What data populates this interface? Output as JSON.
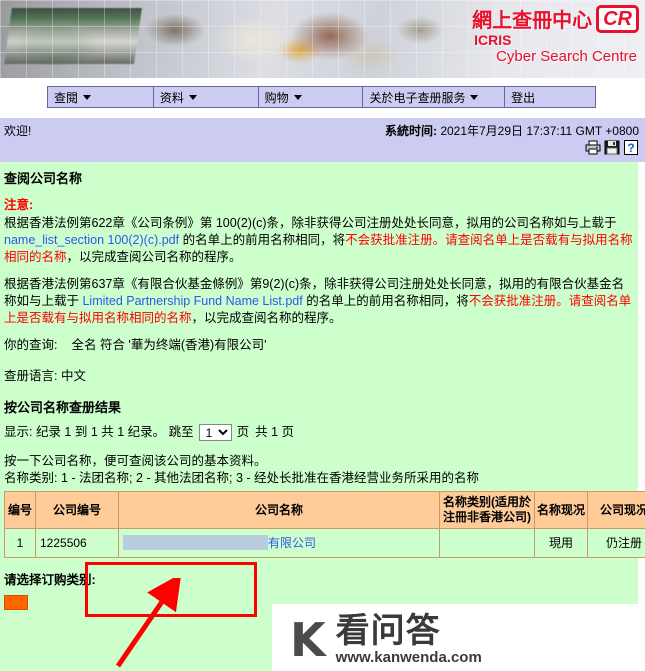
{
  "banner": {
    "logo_cn": "網上查冊中心",
    "logo_badge": "CR",
    "logo_icris": "ICRIS",
    "logo_tagline": "Cyber Search Centre"
  },
  "nav": {
    "items": [
      {
        "label": "查閱",
        "has_caret": true
      },
      {
        "label": "资料",
        "has_caret": true
      },
      {
        "label": "购物",
        "has_caret": true
      },
      {
        "label": "关於电子查册服务",
        "has_caret": true
      },
      {
        "label": "登出",
        "has_caret": false
      }
    ]
  },
  "welcome": {
    "greeting": "欢迎!",
    "systime_label": "系統时间:",
    "systime_value": "2021年7月29日 17:37:11 GMT +0800",
    "icons": [
      "printer-icon",
      "save-icon",
      "help-icon"
    ]
  },
  "main": {
    "page_title": "查阅公司名称",
    "note_label": "注意:",
    "para1": {
      "a": "根据香港法例第622章《公司条例》第 100(2)(c)条，除非获得公司注册处处长同意，拟用的公司名称如与上载于 ",
      "link": "name_list_section 100(2)(c).pdf",
      "b": " 的名单上的前用名称相同，将",
      "red1": "不会获批准注册。",
      "red2": "请查阅名单上是否载有与拟用名称相同的名称",
      "c": "，以完成查阅公司名称的程序。"
    },
    "para2": {
      "a": "根据香港法例第637章《有限合伙基金條例》第9(2)(c)条，除非获得公司注册处处长同意，拟用的有限合伙基金名称如与上载于 ",
      "link": "Limited Partnership Fund Name List.pdf",
      "b": " 的名单上的前用名称相同，将",
      "red1": "不会获批准注册。",
      "red2": "请查阅名单上是否载有与拟用名称相同的名称",
      "c": "，以完成查阅名称的程序。"
    },
    "query_label": "你的查询:",
    "query_value": "全名 符合 '華为终端(香港)有限公司'",
    "language_label": "查册语言:",
    "language_value": "中文",
    "results_heading": "按公司名称查册结果",
    "display_prefix": "显示: 纪录 1 到 1 共 1 纪录。 跳至",
    "page_selected": "1",
    "page_options": [
      "1"
    ],
    "display_suffix_1": "页",
    "display_suffix_2": "共 1 页",
    "hint1": "按一下公司名称，便可查阅该公司的基本资料。",
    "hint2": "名称类别: 1 - 法团名称; 2 - 其他法团名称; 3 - 经处长批准在香港经营业务所采用的名称",
    "table": {
      "headers": [
        "编号",
        "公司编号",
        "公司名称",
        "名称类别(适用於注冊非香港公司)",
        "名称现况",
        "公司现况"
      ],
      "rows": [
        {
          "no": "1",
          "company_number": "1225506",
          "company_name_visible": "有限公司",
          "name_type": "",
          "name_status": "現用",
          "company_status": "仍注册"
        }
      ]
    },
    "order_label": "请选择订购类别:"
  },
  "watermark": {
    "mark": "K",
    "cn": "看问答",
    "url": "www.kanwenda.com"
  },
  "colors": {
    "nav_bg": "#ccccf2",
    "content_bg": "#ccffcc",
    "table_header_bg": "#ffcc99",
    "link": "#3355ee",
    "alert": "#ff0000",
    "brand": "#e8112d",
    "annotation": "#ff0000"
  }
}
